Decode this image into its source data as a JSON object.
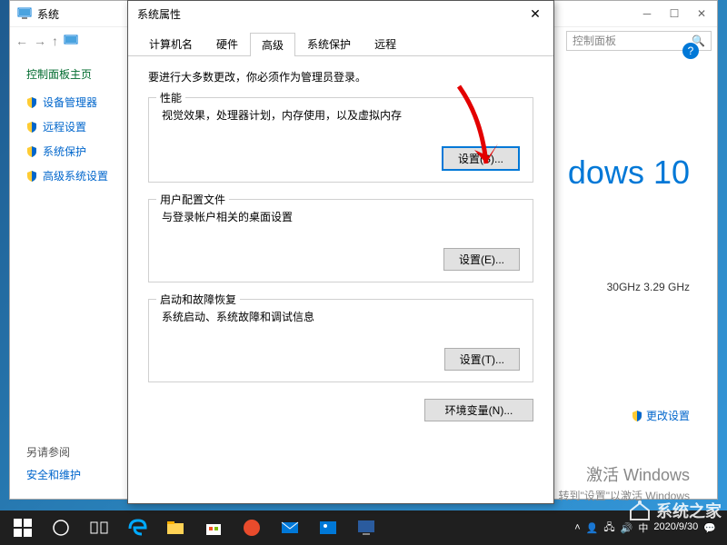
{
  "parent_window": {
    "title": "系统",
    "search_placeholder": "控制面板",
    "sidebar": {
      "home": "控制面板主页",
      "items": [
        "设备管理器",
        "远程设置",
        "系统保护",
        "高级系统设置"
      ],
      "see_also": "另请参阅",
      "security": "安全和维护"
    },
    "logo_text": "dows 10",
    "cpu": "30GHz  3.29 GHz",
    "change_settings": "更改设置",
    "activate_title": "激活 Windows",
    "activate_sub": "转到\"设置\"以激活 Windows"
  },
  "dialog": {
    "title": "系统属性",
    "tabs": [
      "计算机名",
      "硬件",
      "高级",
      "系统保护",
      "远程"
    ],
    "active_tab": 2,
    "notice": "要进行大多数更改，你必须作为管理员登录。",
    "groups": [
      {
        "title": "性能",
        "desc": "视觉效果，处理器计划，内存使用，以及虚拟内存",
        "btn": "设置(S)..."
      },
      {
        "title": "用户配置文件",
        "desc": "与登录帐户相关的桌面设置",
        "btn": "设置(E)..."
      },
      {
        "title": "启动和故障恢复",
        "desc": "系统启动、系统故障和调试信息",
        "btn": "设置(T)..."
      }
    ],
    "env_btn": "环境变量(N)..."
  },
  "taskbar": {
    "time": "",
    "date": "2020/9/30"
  },
  "watermark": "系统之家"
}
